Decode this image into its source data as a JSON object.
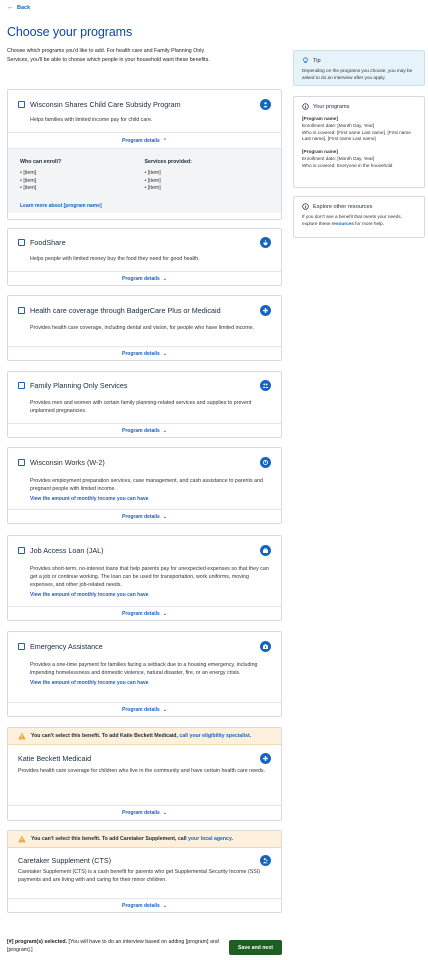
{
  "back_label": "Back",
  "page_title": "Choose your programs",
  "intro": "Choose which programs you'd like to add. For health care and Family Planning Only Services, you'll be able to choose which people in your household want these benefits.",
  "programs": [
    {
      "title": "Wisconsin Shares Child Care Subsidy Program",
      "icon": "child-care-icon",
      "desc": "Helps families with limited income pay for child care.",
      "details_label": "Program details",
      "expanded": true,
      "who_heading": "Who can enroll?",
      "who_items": [
        "[item]",
        "[item]",
        "[item]"
      ],
      "services_heading": "Services provided:",
      "services_items": [
        "[item]",
        "[item]",
        "[item]"
      ],
      "learn_more": "Learn more about [program name]"
    },
    {
      "title": "FoodShare",
      "icon": "food-icon",
      "desc": "Helps people with limited money buy the food they need for good health.",
      "details_label": "Program details"
    },
    {
      "title": "Health care coverage through BadgerCare Plus or Medicaid",
      "icon": "health-plus-icon",
      "desc": "Provides health care coverage, including dental and vision, for people who have limited income.",
      "details_label": "Program details"
    },
    {
      "title": "Family Planning Only Services",
      "icon": "family-icon",
      "desc": "Provides men and women with certain family planning-related services and supplies to prevent unplanned pregnancies.",
      "details_label": "Program details"
    },
    {
      "title": "Wisconsin Works (W-2)",
      "icon": "work-icon",
      "desc": "Provides employment preparation services, case management, and cash assistance to parents and pregnant people with limited income.",
      "link": "View the amount of monthly income you can have",
      "details_label": "Program details"
    },
    {
      "title": "Job Access Loan (JAL)",
      "icon": "briefcase-icon",
      "desc": "Provides short-term, no-interest loans that help parents pay for unexpected expenses so that they can get a job or continue working. The loan can be used for transportation, work uniforms, moving expenses, and other job-related needs.",
      "link": "View the amount of monthly income you can have",
      "details_label": "Program details"
    },
    {
      "title": "Emergency Assistance",
      "icon": "emergency-icon",
      "desc": "Provides a one-time payment for families facing a setback due to a housing emergency, including impending homelessness and domestic violence, natural disaster, fire, or an energy crisis.",
      "link": "View the amount of monthly income you can have",
      "details_label": "Program details"
    }
  ],
  "restricted": [
    {
      "warning": "You can't select this benefit. To add Katie Beckett Medicaid, ",
      "warning_link": "call your eligibility specialist",
      "warning_end": ".",
      "title": "Katie Beckett Medicaid",
      "icon": "health-plus-icon",
      "desc": "Provides health care coverage for children who live in the community and have certain health care needs.",
      "details_label": "Program details"
    },
    {
      "warning": "You can't select this benefit. To add Caretaker Supplement, call ",
      "warning_link": "your local agency",
      "warning_end": ".",
      "title": "Caretaker Supplement (CTS)",
      "icon": "caretaker-icon",
      "desc": "Caretaker Supplement (CTS) is a cash benefit for parents who get Supplemental Security Income (SSI) payments and are living with and caring for their minor children.",
      "details_label": "Program details"
    }
  ],
  "tip": {
    "heading": "Tip",
    "text": "Depending on the programs you choose, you may be asked to do an interview after you apply."
  },
  "your_programs": {
    "heading": "Your programs",
    "entries": [
      {
        "name": "[Program name]",
        "line1": "Enrollment date: [Month Day, Year]",
        "line2": "Who is covered: [First name Last name], [First name Last name], [First name Last name]"
      },
      {
        "name": "[Program name]",
        "line1": "Enrollment date: [Month Day, Year]",
        "line2": "Who is covered: Everyone in the household"
      }
    ]
  },
  "explore": {
    "heading": "Explore other resources",
    "text_before": "If you don't see a benefit that meets your needs, explore these ",
    "link": "resources",
    "text_after": " for more help."
  },
  "footer": {
    "count": "[#] program(s) selected.",
    "text": " [You will have to do an interview based on adding [program] and [program].]",
    "save_label": "Save and next"
  },
  "colors": {
    "accent": "#1565c0",
    "title": "#0d47a1",
    "save": "#1e5e23",
    "warning_bg": "#fdf0dc",
    "tip_bg": "#e6f3fb"
  }
}
